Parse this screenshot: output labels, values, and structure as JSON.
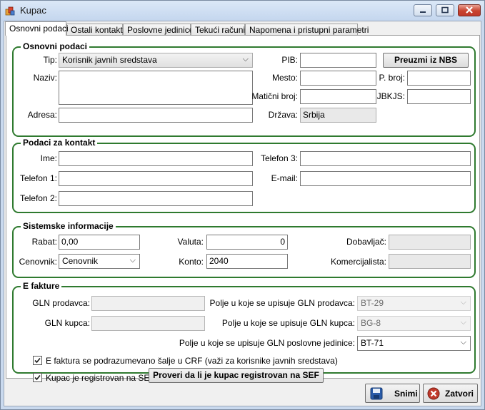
{
  "window": {
    "title": "Kupac"
  },
  "tabs": [
    "Osnovni podaci",
    "Ostali kontakti",
    "Poslovne jedinice",
    "Tekući računi",
    "Napomena i pristupni parametri"
  ],
  "osnovni": {
    "title": "Osnovni podaci",
    "tip_label": "Tip:",
    "tip_value": "Korisnik javnih sredstava",
    "naziv_label": "Naziv:",
    "naziv_value": "",
    "adresa_label": "Adresa:",
    "adresa_value": "",
    "pib_label": "PIB:",
    "pib_value": "",
    "nbs_button": "Preuzmi iz NBS",
    "mesto_label": "Mesto:",
    "mesto_value": "",
    "pbroj_label": "P. broj:",
    "pbroj_value": "",
    "maticni_label": "Matični broj:",
    "maticni_value": "",
    "jbkjs_label": "JBKJS:",
    "jbkjs_value": "",
    "drzava_label": "Država:",
    "drzava_value": "Srbija"
  },
  "kontakt": {
    "title": "Podaci za kontakt",
    "ime_label": "Ime:",
    "telefon1_label": "Telefon 1:",
    "telefon2_label": "Telefon 2:",
    "telefon3_label": "Telefon 3:",
    "email_label": "E-mail:"
  },
  "sistem": {
    "title": "Sistemske informacije",
    "rabat_label": "Rabat:",
    "rabat_value": "0,00",
    "cenovnik_label": "Cenovnik:",
    "cenovnik_value": "Cenovnik",
    "valuta_label": "Valuta:",
    "valuta_value": "0",
    "konto_label": "Konto:",
    "konto_value": "2040",
    "dobavljac_label": "Dobavljač:",
    "komercijalista_label": "Komercijalista:"
  },
  "efakture": {
    "title": "E fakture",
    "gln_prodavca_label": "GLN prodavca:",
    "gln_kupca_label": "GLN kupca:",
    "polje_prodavca_label": "Polje u koje se upisuje GLN prodavca:",
    "polje_prodavca_value": "BT-29",
    "polje_kupca_label": "Polje u koje se upisuje GLN kupca:",
    "polje_kupca_value": "BG-8",
    "polje_pj_label": "Polje u koje se upisuje GLN poslovne jedinice:",
    "polje_pj_value": "BT-71",
    "crf_check_label": "E faktura se podrazumevano šalje u CRF (važi za korisnike javnih sredstava)",
    "sef_check_label": "Kupac je registrovan na SEF",
    "sef_button": "Proveri da li je kupac registrovan na SEF"
  },
  "footer": {
    "save_label": "Snimi",
    "close_label": "Zatvori"
  },
  "colors": {
    "group_border": "#2f7a2f",
    "close_accent": "#c0392b"
  }
}
